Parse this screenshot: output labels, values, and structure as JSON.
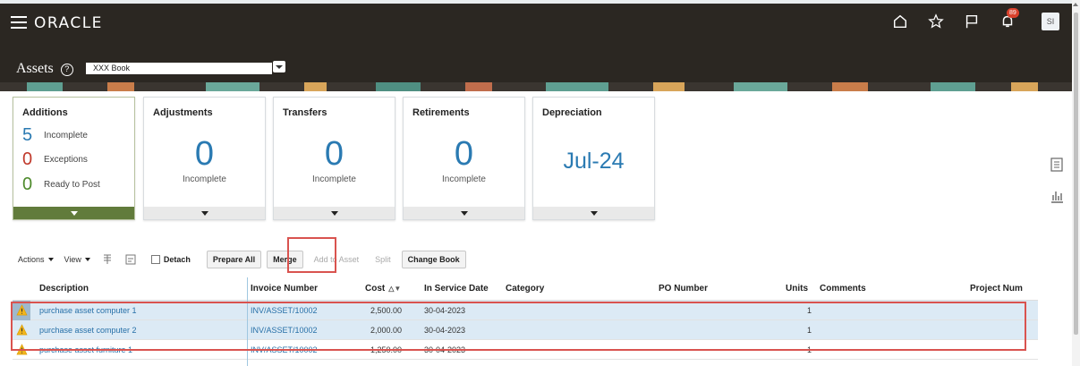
{
  "header": {
    "logo": "ORACLE",
    "page_title": "Assets",
    "help_icon": "?",
    "book_value": "XXX Book",
    "notification_count": "89",
    "avatar_initials": "SI"
  },
  "tiles": {
    "additions": {
      "title": "Additions",
      "rows": [
        {
          "num": "5",
          "label": "Incomplete",
          "color": "#2a7ab2"
        },
        {
          "num": "0",
          "label": "Exceptions",
          "color": "#c0392b"
        },
        {
          "num": "0",
          "label": "Ready to Post",
          "color": "#4d8a2b"
        }
      ]
    },
    "adjustments": {
      "title": "Adjustments",
      "value": "0",
      "sub": "Incomplete"
    },
    "transfers": {
      "title": "Transfers",
      "value": "0",
      "sub": "Incomplete"
    },
    "retirements": {
      "title": "Retirements",
      "value": "0",
      "sub": "Incomplete"
    },
    "depreciation": {
      "title": "Depreciation",
      "value": "Jul-24"
    }
  },
  "toolbar": {
    "actions": "Actions",
    "view": "View",
    "detach": "Detach",
    "prepare_all": "Prepare All",
    "merge": "Merge",
    "add_to_asset": "Add to Asset",
    "split": "Split",
    "change_book": "Change Book"
  },
  "table": {
    "headers": {
      "description": "Description",
      "invoice": "Invoice Number",
      "cost": "Cost",
      "in_service": "In Service Date",
      "category": "Category",
      "po": "PO Number",
      "units": "Units",
      "comments": "Comments",
      "project": "Project Num"
    },
    "rows": [
      {
        "description": "purchase asset computer 1",
        "invoice": "INV/ASSET/10002",
        "cost": "2,500.00",
        "date": "30-04-2023",
        "units": "1"
      },
      {
        "description": "purchase asset computer 2",
        "invoice": "INV/ASSET/10002",
        "cost": "2,000.00",
        "date": "30-04-2023",
        "units": "1"
      },
      {
        "description": "purchase asset furniture 1",
        "invoice": "INV/ASSET/10002",
        "cost": "1,250.00",
        "date": "30-04-2023",
        "units": "1"
      }
    ]
  },
  "colors": {
    "header_bg": "#2b2722",
    "accent_blue": "#2a7ab2",
    "tile_selected": "#617b3b",
    "highlight": "#d9534f",
    "row_selected": "#dceaf5"
  },
  "icons": {
    "menu": "hamburger-icon",
    "home": "home-icon",
    "favorite": "star-icon",
    "flag": "flag-icon",
    "notifications": "bell-icon",
    "warning": "warning-icon"
  }
}
